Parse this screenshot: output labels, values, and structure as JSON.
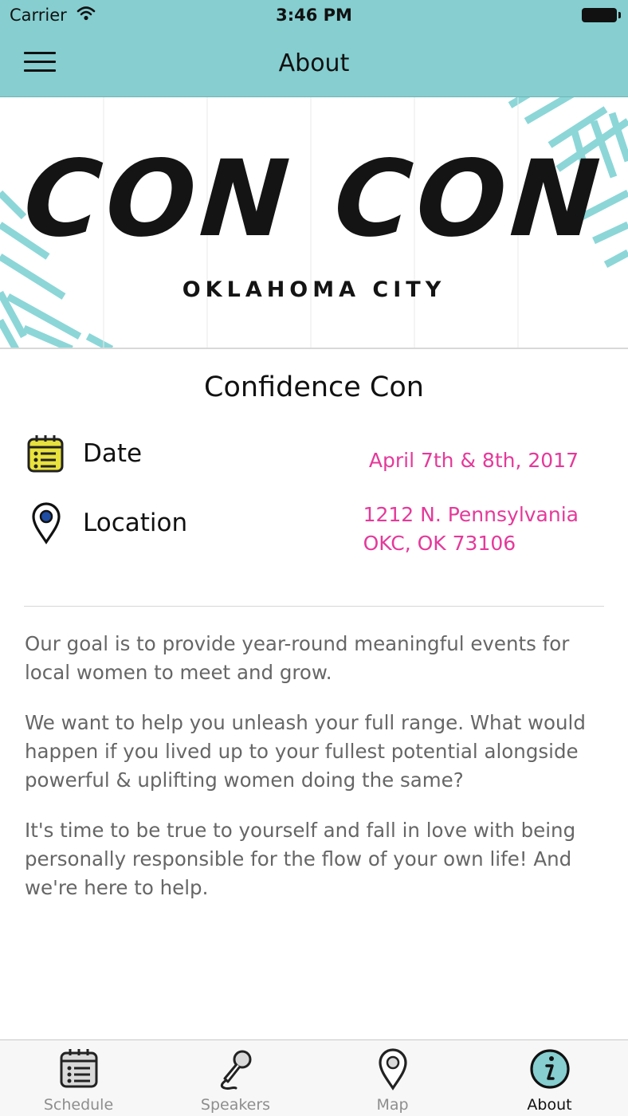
{
  "status_bar": {
    "carrier": "Carrier",
    "time": "3:46 PM"
  },
  "nav": {
    "title": "About",
    "menu_icon": "hamburger-icon"
  },
  "banner": {
    "logo_text": "CON CON",
    "logo_subtitle": "OKLAHOMA CITY",
    "accent_color": "#86ced0"
  },
  "event": {
    "title": "Confidence Con",
    "date_label": "Date",
    "date_value": "April 7th & 8th, 2017",
    "location_label": "Location",
    "location_line1": "1212 N. Pennsylvania",
    "location_line2": "OKC, OK 73106",
    "value_color": "#e5399a"
  },
  "about": {
    "paragraphs": [
      "Our goal is to provide year-round meaningful events for local women to meet and grow.",
      "We want to help you unleash your full range. What would happen if you lived up to your fullest potential alongside powerful & uplifting women doing the same?",
      "It's time to be true to yourself and fall in love with being personally responsible for the flow of your own life! And we're here to help."
    ]
  },
  "tabs": [
    {
      "label": "Schedule",
      "icon": "calendar-icon"
    },
    {
      "label": "Speakers",
      "icon": "microphone-icon"
    },
    {
      "label": "Map",
      "icon": "map-pin-icon"
    },
    {
      "label": "About",
      "icon": "info-icon",
      "active": true
    }
  ]
}
